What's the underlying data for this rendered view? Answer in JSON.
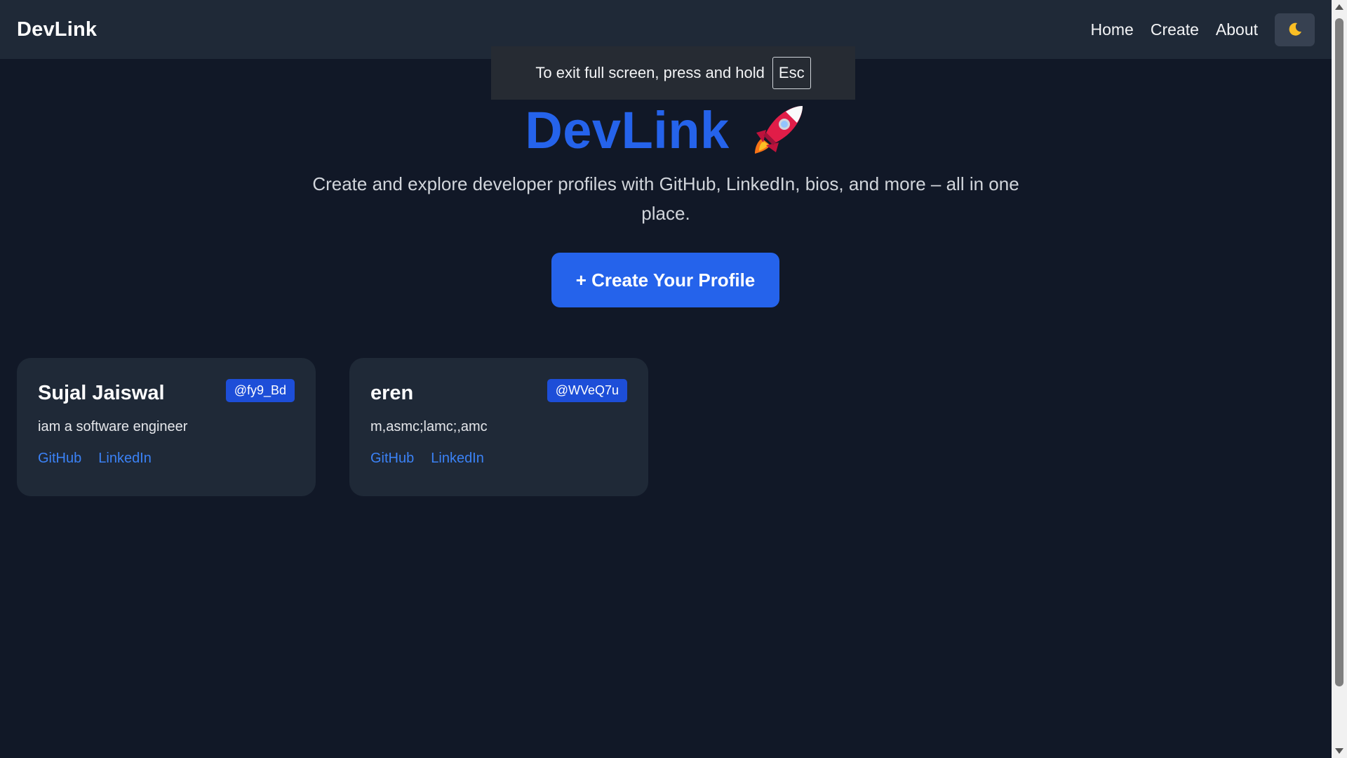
{
  "navbar": {
    "brand": "DevLink",
    "links": [
      "Home",
      "Create",
      "About"
    ],
    "theme_icon": "moon-icon"
  },
  "fullscreen_toast": {
    "message": "To exit full screen, press and hold",
    "key": "Esc"
  },
  "hero": {
    "title": "DevLink",
    "icon": "rocket-icon",
    "subtitle": "Create and explore developer profiles with GitHub, LinkedIn, bios, and more – all in one place.",
    "cta_label": "+ Create Your Profile"
  },
  "profiles": [
    {
      "name": "Sujal Jaiswal",
      "handle": "@fy9_Bd",
      "bio": "iam a software engineer",
      "links": [
        "GitHub",
        "LinkedIn"
      ]
    },
    {
      "name": "eren",
      "handle": "@WVeQ7u",
      "bio": "m,asmc;lamc;,amc",
      "links": [
        "GitHub",
        "LinkedIn"
      ]
    }
  ],
  "colors": {
    "background": "#111827",
    "navbar": "#1f2937",
    "card": "#1f2937",
    "accent": "#2563eb",
    "badge": "#1d4ed8",
    "link": "#3b82f6"
  }
}
